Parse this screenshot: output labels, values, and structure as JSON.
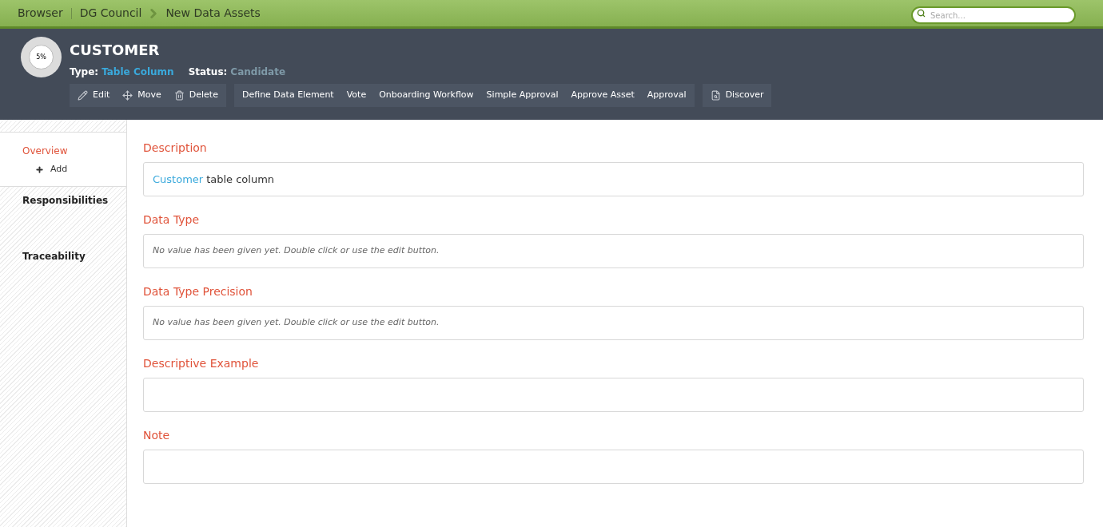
{
  "breadcrumb": [
    {
      "label": "Browser"
    },
    {
      "label": "DG Council"
    },
    {
      "label": "New Data Assets"
    }
  ],
  "search": {
    "placeholder": "Search..."
  },
  "asset": {
    "progress": "5%",
    "title": "CUSTOMER",
    "type_label": "Type:",
    "type_value": "Table Column",
    "status_label": "Status:",
    "status_value": "Candidate"
  },
  "toolbar_groups": [
    {
      "buttons": [
        {
          "label": "Edit"
        },
        {
          "label": "Move"
        },
        {
          "label": "Delete"
        }
      ]
    },
    {
      "buttons": [
        {
          "label": "Define Data Element"
        },
        {
          "label": "Vote"
        },
        {
          "label": "Onboarding Workflow"
        },
        {
          "label": "Simple Approval"
        },
        {
          "label": "Approve Asset"
        },
        {
          "label": "Approval"
        }
      ]
    },
    {
      "buttons": [
        {
          "label": "Discover"
        }
      ]
    }
  ],
  "sidebar": [
    {
      "kind": "section",
      "label": "Overview",
      "selected": true
    },
    {
      "kind": "action",
      "label": "Add"
    },
    {
      "kind": "section",
      "label": "Responsibilities",
      "selected": false
    },
    {
      "kind": "section",
      "label": "Traceability",
      "selected": false
    }
  ],
  "fields": [
    {
      "label": "Description",
      "kind": "text",
      "link": "Customer",
      "value": "table column"
    },
    {
      "label": "Data Type",
      "kind": "empty",
      "hint": "No value has been given yet. Double click or use the edit button."
    },
    {
      "label": "Data Type Precision",
      "kind": "empty",
      "hint": "No value has been given yet. Double click or use the edit button."
    },
    {
      "label": "Descriptive Example",
      "kind": "blank"
    },
    {
      "label": "Note",
      "kind": "blank"
    }
  ]
}
